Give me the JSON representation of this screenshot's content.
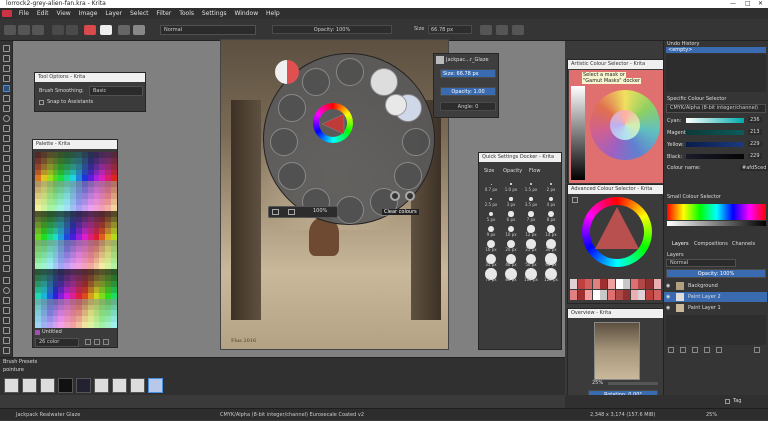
{
  "window": {
    "title": "lorrock2-grey-alien-fan.kra - Krita",
    "minimize": "—",
    "maximize": "□",
    "close": "✕"
  },
  "menu": [
    "File",
    "Edit",
    "View",
    "Image",
    "Layer",
    "Select",
    "Filter",
    "Tools",
    "Settings",
    "Window",
    "Help"
  ],
  "toolbar": {
    "blend_mode": "Normal",
    "opacity": "Opacity: 100%",
    "size": "Size",
    "size_value": "66.78 px"
  },
  "tool_options": {
    "title": "Tool Options - Krita",
    "smoothing_label": "Brush Smoothing:",
    "smoothing_value": "Basic",
    "snap_label": "Snap to Assistants"
  },
  "palette": {
    "title": "Palette - Krita",
    "name": "Untitled",
    "set": "26 color"
  },
  "brush_editor": {
    "title": "Jackpac...r_Glaze",
    "size": "Size: 66.78 px",
    "opacity": "Opacity: 1.00",
    "angle": "Angle: 0"
  },
  "popup": {
    "zoom": "100%",
    "clear_colours": "Clear colours"
  },
  "quick_settings": {
    "title": "Quick Settings Docker - Krita",
    "tabs": [
      "Size",
      "Opacity",
      "Flow"
    ],
    "sizes": [
      "0.7 px",
      "1.0 px",
      "1.5 px",
      "2 px",
      "2.5 px",
      "3 px",
      "3.5 px",
      "4 px",
      "5 px",
      "6 px",
      "7 px",
      "8 px",
      "9 px",
      "10 px",
      "12 px",
      "14 px",
      "16 px",
      "20 px",
      "25 px",
      "30 px",
      "35 px",
      "40 px",
      "50 px",
      "60 px",
      "70 px",
      "80 px",
      "100 px",
      "120 px"
    ]
  },
  "artistic_selector": {
    "title": "Artistic Colour Selector - Krita",
    "tooltip_line1": "Select a mask or",
    "tooltip_line2": "\"Gamut Masks\" docker"
  },
  "advanced_selector": {
    "title": "Advanced Colour Selector - Krita"
  },
  "overview": {
    "title": "Overview - Krita",
    "zoom": "25%",
    "rotation": "Rotation: 0.00°"
  },
  "undo_history": {
    "title": "Undo History",
    "item": "<empty>"
  },
  "specific_selector": {
    "title": "Specific Colour Selector",
    "model": "CMYK/Alpha (8-bit integer/channel)",
    "channels": [
      {
        "name": "Cyan:",
        "value": "236"
      },
      {
        "name": "Magenta:",
        "value": "213"
      },
      {
        "name": "Yellow:",
        "value": "229"
      },
      {
        "name": "Black:",
        "value": "229"
      }
    ],
    "colour_name_label": "Colour name:",
    "colour_name_value": "#afd5ced"
  },
  "small_selector": {
    "title": "Small Colour Selector"
  },
  "layers": {
    "tabs": [
      "Layers",
      "Compositions",
      "Channels"
    ],
    "title": "Layers",
    "blend": "Normal",
    "opacity": "Opacity: 100%",
    "items": [
      {
        "name": "Background"
      },
      {
        "name": "Paint Layer 2"
      },
      {
        "name": "Paint Layer 1"
      }
    ]
  },
  "brush_presets": {
    "title": "Brush Presets",
    "tag": "pointure",
    "tag_right": "Tag"
  },
  "status": {
    "brush": "Jackpack Realwater Glaze",
    "colorspace": "CMYK/Alpha (8-bit integer/channel)  Eurosecale Coated v2",
    "dims": "2,348 x 3,174 (157.6 MiB)",
    "zoom": "25%"
  },
  "canvas_signature": "Flus 2016"
}
